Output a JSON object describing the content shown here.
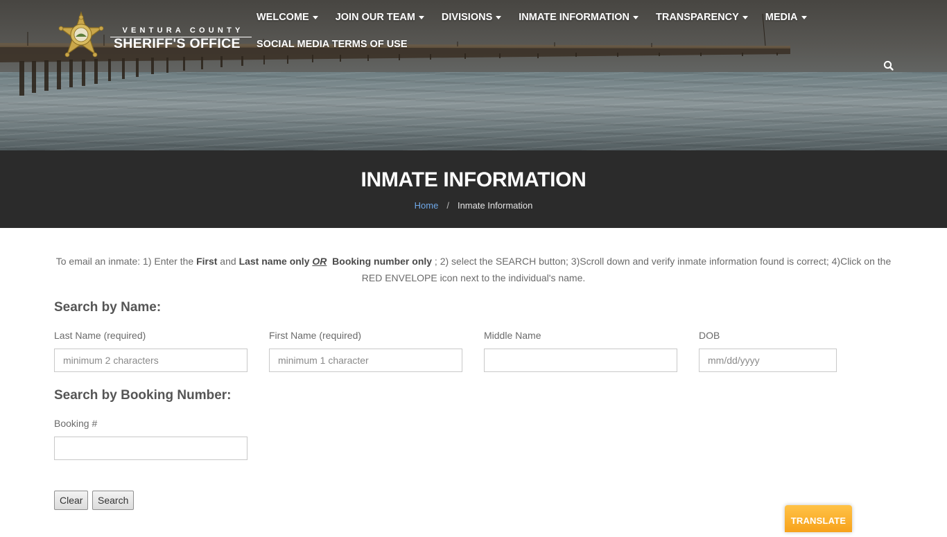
{
  "header": {
    "brand_top": "VENTURA COUNTY",
    "brand_main": "SHERIFF'S OFFICE",
    "nav_row1": [
      {
        "label": "WELCOME"
      },
      {
        "label": "JOIN OUR TEAM"
      },
      {
        "label": "DIVISIONS"
      },
      {
        "label": "INMATE INFORMATION"
      },
      {
        "label": "TRANSPARENCY"
      },
      {
        "label": "MEDIA"
      }
    ],
    "nav_row2": [
      {
        "label": "SOCIAL MEDIA TERMS OF USE"
      }
    ],
    "search_icon": "search-icon"
  },
  "page": {
    "title": "INMATE INFORMATION",
    "breadcrumb": {
      "home": "Home",
      "separator": "/",
      "current": "Inmate Information"
    }
  },
  "intro": {
    "p1": "To email an inmate: 1) Enter the ",
    "b1": "First",
    "p2": " and ",
    "b2": "Last name only",
    "or": "OR",
    "b3": "Booking number only",
    "p3": " ; 2) select the SEARCH button;  3)Scroll down and verify inmate information found is correct; 4)Click on the RED ENVELOPE icon next to the individual's name."
  },
  "search_by_name": {
    "title": "Search by Name:",
    "last_name": {
      "label": "Last Name (required)",
      "value": "",
      "placeholder": "minimum 2 characters"
    },
    "first_name": {
      "label": "First Name (required)",
      "value": "",
      "placeholder": "minimum 1 character"
    },
    "middle_name": {
      "label": "Middle Name",
      "value": "",
      "placeholder": ""
    },
    "dob": {
      "label": "DOB",
      "value": "",
      "placeholder": "mm/dd/yyyy"
    }
  },
  "search_by_booking": {
    "title": "Search by Booking Number:",
    "booking": {
      "label": "Booking #",
      "value": "",
      "placeholder": ""
    }
  },
  "buttons": {
    "clear": "Clear",
    "search": "Search"
  },
  "translate": {
    "label": "TRANSLATE"
  },
  "colors": {
    "titlebar_bg": "#2b2b2b",
    "link": "#6fa8e8",
    "translate": "#f7a21b"
  }
}
